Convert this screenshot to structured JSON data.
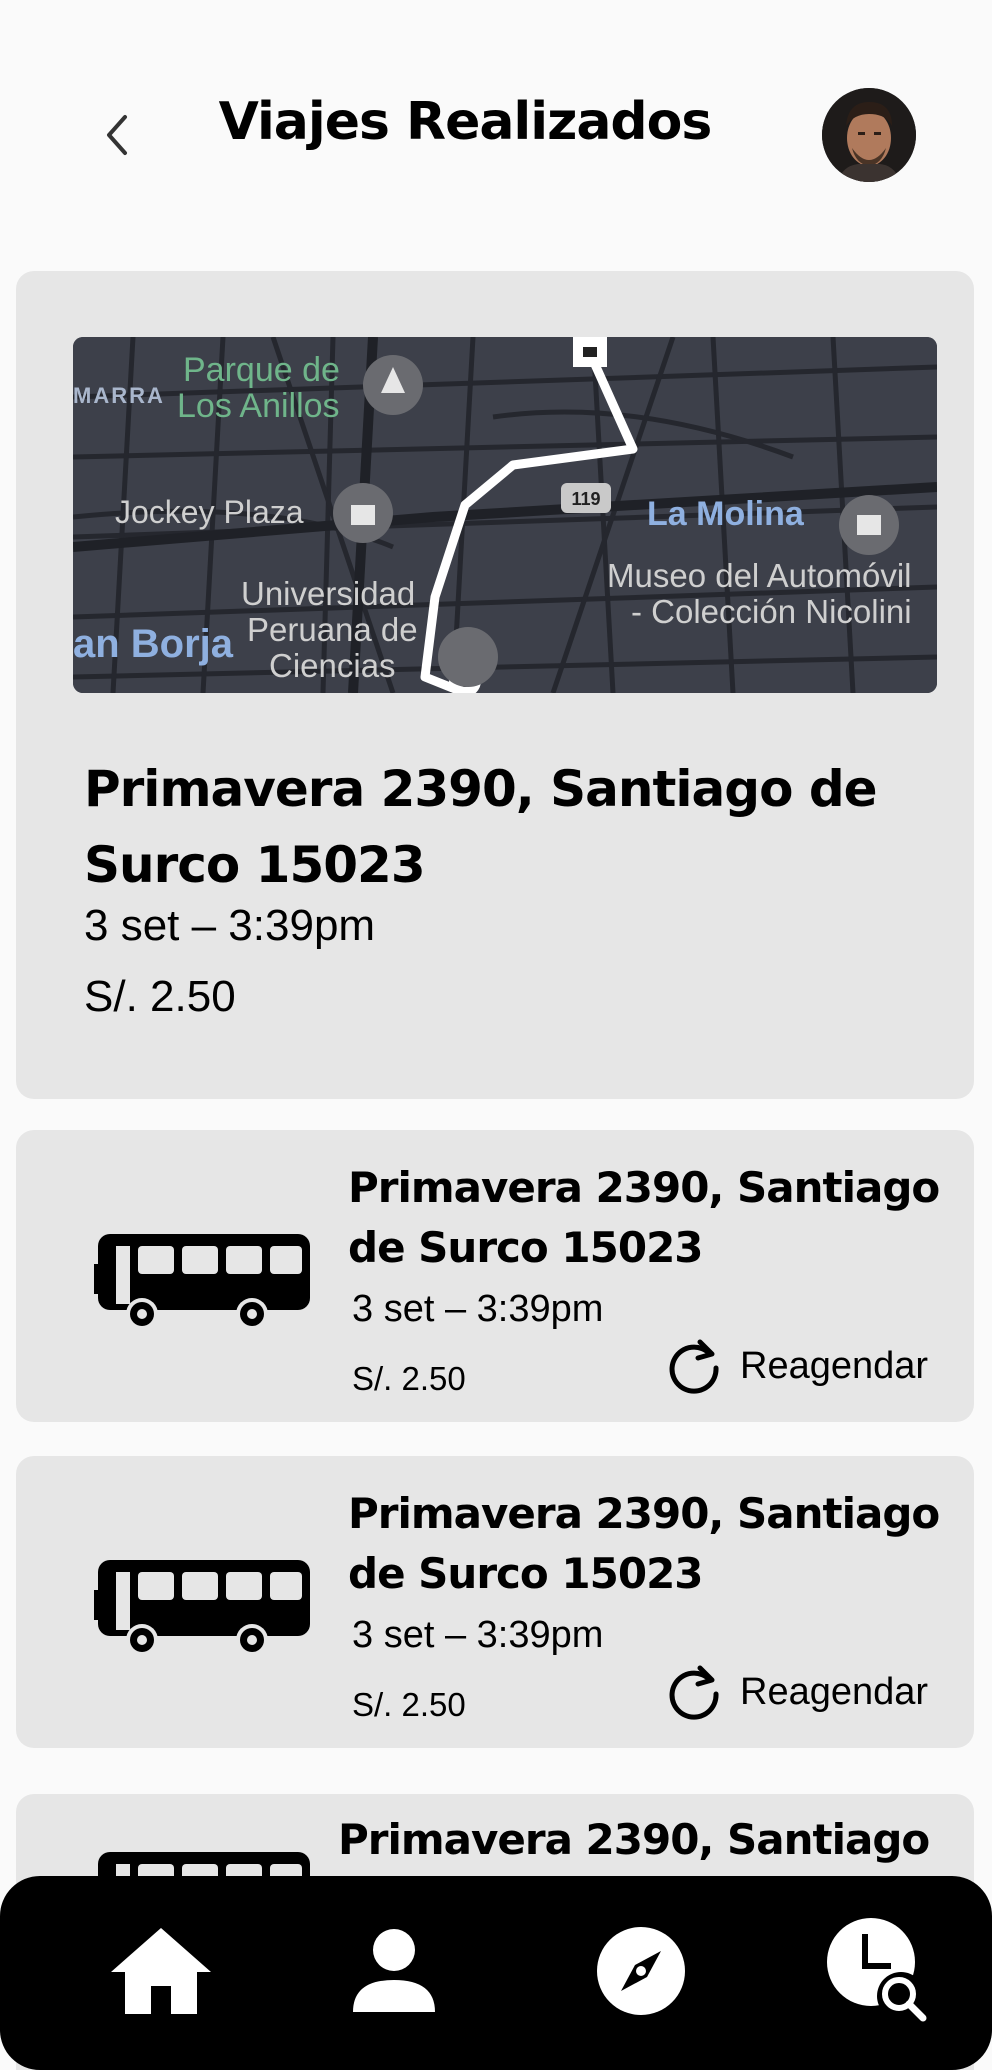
{
  "header": {
    "title": "Viajes Realizados"
  },
  "featured_trip": {
    "map_labels": {
      "marra": "MARRA",
      "parque_line1": "Parque de",
      "parque_line2": "Los Anillos",
      "jockey": "Jockey Plaza",
      "highway": "119",
      "la_molina": "La Molina",
      "museo_line1": "Museo del Automóvil",
      "museo_line2": "- Colección Nicolini",
      "san_borja": "an Borja",
      "univ_line1": "Universidad",
      "univ_line2": "Peruana de",
      "univ_line3": "Ciencias"
    },
    "address": "Primavera 2390, Santiago de Surco 15023",
    "date": "3 set – 3:39pm",
    "price": "S/. 2.50"
  },
  "trips": [
    {
      "address": "Primavera 2390, Santiago de Surco 15023",
      "date": "3 set – 3:39pm",
      "price": "S/. 2.50",
      "action": "Reagendar"
    },
    {
      "address": "Primavera 2390, Santiago de Surco 15023",
      "date": "3 set – 3:39pm",
      "price": "S/. 2.50",
      "action": "Reagendar"
    },
    {
      "address": "Primavera 2390, Santiago"
    }
  ],
  "nav": {
    "items": [
      "home-icon",
      "profile-icon",
      "compass-icon",
      "history-search-icon"
    ]
  }
}
